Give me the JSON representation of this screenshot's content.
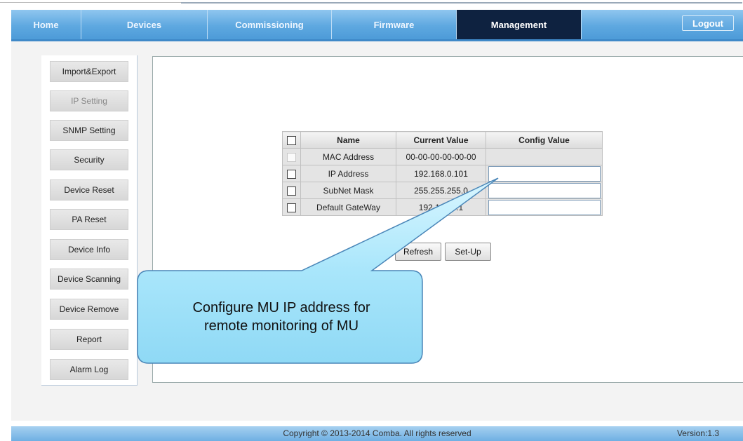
{
  "nav": {
    "tabs": [
      {
        "label": "Home"
      },
      {
        "label": "Devices"
      },
      {
        "label": "Commissioning"
      },
      {
        "label": "Firmware"
      },
      {
        "label": "Management"
      }
    ],
    "active_tab": "Management",
    "logout_label": "Logout"
  },
  "sidebar": {
    "items": [
      {
        "label": "Import&Export"
      },
      {
        "label": "IP Setting"
      },
      {
        "label": "SNMP Setting"
      },
      {
        "label": "Security"
      },
      {
        "label": "Device Reset"
      },
      {
        "label": "PA Reset"
      },
      {
        "label": "Device Info"
      },
      {
        "label": "Device Scanning"
      },
      {
        "label": "Device Remove"
      },
      {
        "label": "Report"
      },
      {
        "label": "Alarm Log"
      }
    ],
    "selected": "IP Setting"
  },
  "table": {
    "headers": {
      "name": "Name",
      "current": "Current Value",
      "config": "Config Value"
    },
    "rows": [
      {
        "name": "MAC Address",
        "current": "00-00-00-00-00-00"
      },
      {
        "name": "IP Address",
        "current": "192.168.0.101"
      },
      {
        "name": "SubNet Mask",
        "current": "255.255.255.0"
      },
      {
        "name": "Default GateWay",
        "current": "192.168.0.1"
      }
    ]
  },
  "actions": {
    "refresh_label": "Refresh",
    "setup_label": "Set-Up"
  },
  "callout": {
    "line1": "Configure MU IP address for",
    "line2": "remote monitoring of MU"
  },
  "footer": {
    "copyright": "Copyright © 2013-2014 Comba. All rights reserved",
    "version": "Version:1.3"
  },
  "colors": {
    "nav_active": "#0e2240",
    "nav_bg": "#5ea8e0",
    "callout_fill": "#a9e6fb",
    "callout_border": "#4a86b8"
  }
}
